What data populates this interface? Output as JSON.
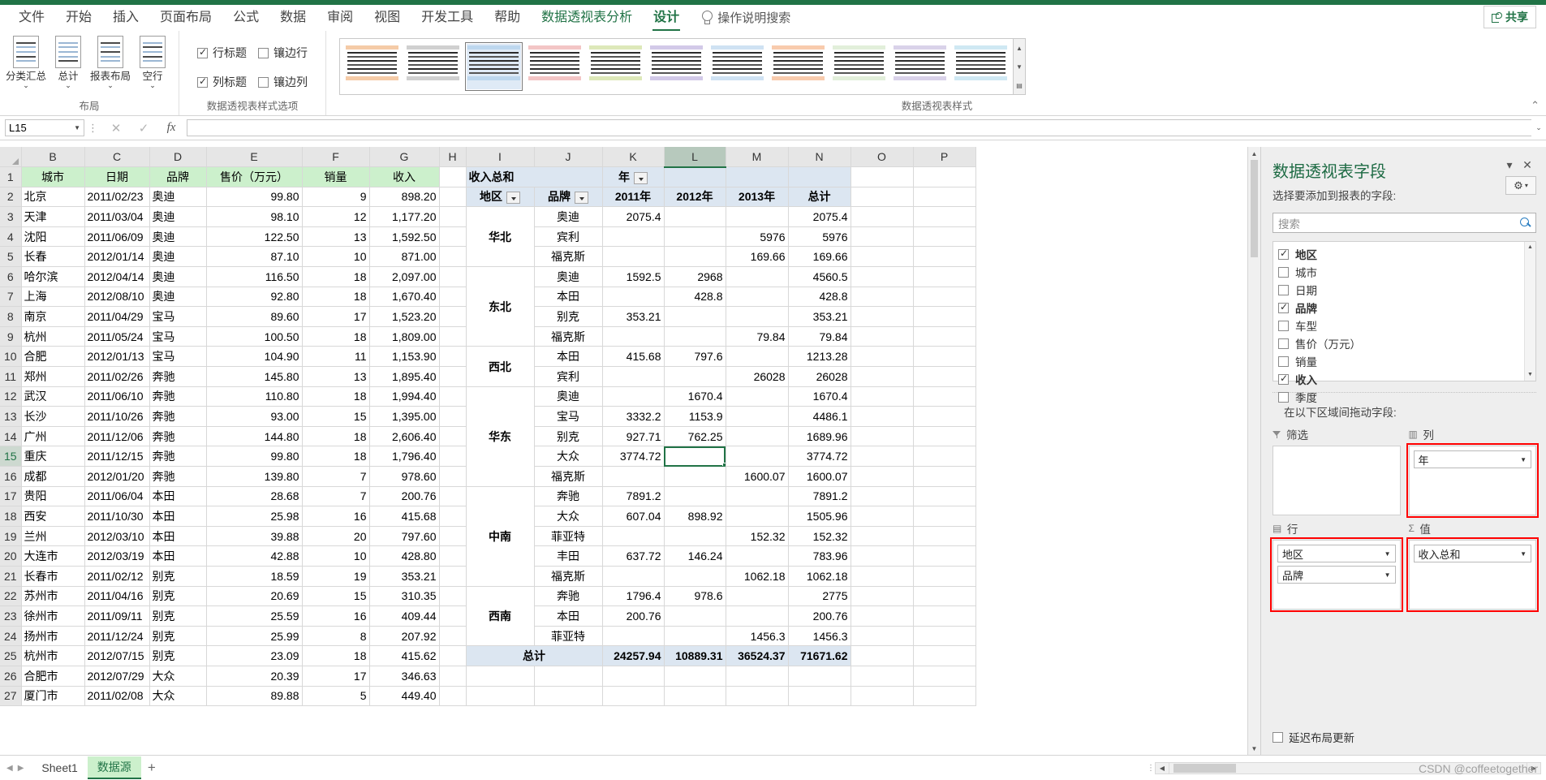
{
  "ribbon": {
    "tabs": [
      {
        "label": "文件",
        "state": "normal"
      },
      {
        "label": "开始",
        "state": "normal"
      },
      {
        "label": "插入",
        "state": "normal"
      },
      {
        "label": "页面布局",
        "state": "normal"
      },
      {
        "label": "公式",
        "state": "normal"
      },
      {
        "label": "数据",
        "state": "normal"
      },
      {
        "label": "审阅",
        "state": "normal"
      },
      {
        "label": "视图",
        "state": "normal"
      },
      {
        "label": "开发工具",
        "state": "normal"
      },
      {
        "label": "帮助",
        "state": "normal"
      },
      {
        "label": "数据透视表分析",
        "state": "context"
      },
      {
        "label": "设计",
        "state": "active"
      }
    ],
    "tell_me": "操作说明搜索",
    "share_label": "共享",
    "layout_group": {
      "title": "布局",
      "buttons": [
        {
          "label": "分类汇总",
          "has_caret": true
        },
        {
          "label": "总计",
          "has_caret": true
        },
        {
          "label": "报表布局",
          "has_caret": true
        },
        {
          "label": "空行",
          "has_caret": true
        }
      ]
    },
    "style_options_group": {
      "title": "数据透视表样式选项",
      "options": [
        {
          "label": "行标题",
          "checked": true
        },
        {
          "label": "镶边行",
          "checked": false
        },
        {
          "label": "列标题",
          "checked": true
        },
        {
          "label": "镶边列",
          "checked": false
        }
      ]
    },
    "styles_group": {
      "title": "数据透视表样式",
      "swatch_colors": [
        "#f5cba7",
        "#d0d0d0",
        "#bdd7ee",
        "#f3c5c5",
        "#dde8b9",
        "#d2c9e8",
        "#cfe2f3",
        "#f8cbad",
        "#e2efda",
        "#d9d2e9",
        "#cfe8f3"
      ],
      "selected_index": 2
    }
  },
  "formula_bar": {
    "name_box": "L15",
    "value": "",
    "cancel_icon": "✕",
    "confirm_icon": "✓",
    "fx_icon": "fx"
  },
  "sheet": {
    "column_headers": [
      "B",
      "C",
      "D",
      "E",
      "F",
      "G",
      "H",
      "I",
      "J",
      "K",
      "L",
      "M",
      "N",
      "O",
      "P"
    ],
    "selected_column": "L",
    "selected_row": 15,
    "selected_cell": "L15",
    "row_numbers": [
      1,
      2,
      3,
      4,
      5,
      6,
      7,
      8,
      9,
      10,
      11,
      12,
      13,
      14,
      15,
      16,
      17,
      18,
      19,
      20,
      21,
      22,
      23,
      24,
      25,
      26,
      27
    ],
    "source_headers": [
      "城市",
      "日期",
      "品牌",
      "售价（万元）",
      "销量",
      "收入"
    ],
    "source_rows": [
      [
        "北京",
        "2011/02/23",
        "奥迪",
        "99.80",
        "9",
        "898.20"
      ],
      [
        "天津",
        "2011/03/04",
        "奥迪",
        "98.10",
        "12",
        "1,177.20"
      ],
      [
        "沈阳",
        "2011/06/09",
        "奥迪",
        "122.50",
        "13",
        "1,592.50"
      ],
      [
        "长春",
        "2012/01/14",
        "奥迪",
        "87.10",
        "10",
        "871.00"
      ],
      [
        "哈尔滨",
        "2012/04/14",
        "奥迪",
        "116.50",
        "18",
        "2,097.00"
      ],
      [
        "上海",
        "2012/08/10",
        "奥迪",
        "92.80",
        "18",
        "1,670.40"
      ],
      [
        "南京",
        "2011/04/29",
        "宝马",
        "89.60",
        "17",
        "1,523.20"
      ],
      [
        "杭州",
        "2011/05/24",
        "宝马",
        "100.50",
        "18",
        "1,809.00"
      ],
      [
        "合肥",
        "2012/01/13",
        "宝马",
        "104.90",
        "11",
        "1,153.90"
      ],
      [
        "郑州",
        "2011/02/26",
        "奔驰",
        "145.80",
        "13",
        "1,895.40"
      ],
      [
        "武汉",
        "2011/06/10",
        "奔驰",
        "110.80",
        "18",
        "1,994.40"
      ],
      [
        "长沙",
        "2011/10/26",
        "奔驰",
        "93.00",
        "15",
        "1,395.00"
      ],
      [
        "广州",
        "2011/12/06",
        "奔驰",
        "144.80",
        "18",
        "2,606.40"
      ],
      [
        "重庆",
        "2011/12/15",
        "奔驰",
        "99.80",
        "18",
        "1,796.40"
      ],
      [
        "成都",
        "2012/01/20",
        "奔驰",
        "139.80",
        "7",
        "978.60"
      ],
      [
        "贵阳",
        "2011/06/04",
        "本田",
        "28.68",
        "7",
        "200.76"
      ],
      [
        "西安",
        "2011/10/30",
        "本田",
        "25.98",
        "16",
        "415.68"
      ],
      [
        "兰州",
        "2012/03/10",
        "本田",
        "39.88",
        "20",
        "797.60"
      ],
      [
        "大连市",
        "2012/03/19",
        "本田",
        "42.88",
        "10",
        "428.80"
      ],
      [
        "长春市",
        "2011/02/12",
        "别克",
        "18.59",
        "19",
        "353.21"
      ],
      [
        "苏州市",
        "2011/04/16",
        "别克",
        "20.69",
        "15",
        "310.35"
      ],
      [
        "徐州市",
        "2011/09/11",
        "别克",
        "25.59",
        "16",
        "409.44"
      ],
      [
        "扬州市",
        "2011/12/24",
        "别克",
        "25.99",
        "8",
        "207.92"
      ],
      [
        "杭州市",
        "2012/07/15",
        "别克",
        "23.09",
        "18",
        "415.62"
      ],
      [
        "合肥市",
        "2012/07/29",
        "大众",
        "20.39",
        "17",
        "346.63"
      ],
      [
        "厦门市",
        "2011/02/08",
        "大众",
        "89.88",
        "5",
        "449.40"
      ]
    ]
  },
  "pivot": {
    "value_title": "收入总和",
    "col_field_label": "年",
    "row_field_label": "地区",
    "row_field_label2": "品牌",
    "column_headers": [
      "2011年",
      "2012年",
      "2013年",
      "总计"
    ],
    "grand_total_label": "总计",
    "groups": [
      {
        "region": "华北",
        "rows": [
          {
            "brand": "奥迪",
            "v": [
              "2075.4",
              "",
              "",
              "2075.4"
            ]
          },
          {
            "brand": "宾利",
            "v": [
              "",
              "",
              "5976",
              "5976"
            ]
          },
          {
            "brand": "福克斯",
            "v": [
              "",
              "",
              "169.66",
              "169.66"
            ]
          }
        ]
      },
      {
        "region": "东北",
        "rows": [
          {
            "brand": "奥迪",
            "v": [
              "1592.5",
              "2968",
              "",
              "4560.5"
            ]
          },
          {
            "brand": "本田",
            "v": [
              "",
              "428.8",
              "",
              "428.8"
            ]
          },
          {
            "brand": "别克",
            "v": [
              "353.21",
              "",
              "",
              "353.21"
            ]
          },
          {
            "brand": "福克斯",
            "v": [
              "",
              "",
              "79.84",
              "79.84"
            ]
          }
        ]
      },
      {
        "region": "西北",
        "rows": [
          {
            "brand": "本田",
            "v": [
              "415.68",
              "797.6",
              "",
              "1213.28"
            ]
          },
          {
            "brand": "宾利",
            "v": [
              "",
              "",
              "26028",
              "26028"
            ]
          }
        ]
      },
      {
        "region": "华东",
        "rows": [
          {
            "brand": "奥迪",
            "v": [
              "",
              "1670.4",
              "",
              "1670.4"
            ]
          },
          {
            "brand": "宝马",
            "v": [
              "3332.2",
              "1153.9",
              "",
              "4486.1"
            ]
          },
          {
            "brand": "别克",
            "v": [
              "927.71",
              "762.25",
              "",
              "1689.96"
            ]
          },
          {
            "brand": "大众",
            "v": [
              "3774.72",
              "",
              "",
              "3774.72"
            ]
          },
          {
            "brand": "福克斯",
            "v": [
              "",
              "",
              "1600.07",
              "1600.07"
            ]
          }
        ]
      },
      {
        "region": "中南",
        "rows": [
          {
            "brand": "奔驰",
            "v": [
              "7891.2",
              "",
              "",
              "7891.2"
            ]
          },
          {
            "brand": "大众",
            "v": [
              "607.04",
              "898.92",
              "",
              "1505.96"
            ]
          },
          {
            "brand": "菲亚特",
            "v": [
              "",
              "",
              "152.32",
              "152.32"
            ]
          },
          {
            "brand": "丰田",
            "v": [
              "637.72",
              "146.24",
              "",
              "783.96"
            ]
          },
          {
            "brand": "福克斯",
            "v": [
              "",
              "",
              "1062.18",
              "1062.18"
            ]
          }
        ]
      },
      {
        "region": "西南",
        "rows": [
          {
            "brand": "奔驰",
            "v": [
              "1796.4",
              "978.6",
              "",
              "2775"
            ]
          },
          {
            "brand": "本田",
            "v": [
              "200.76",
              "",
              "",
              "200.76"
            ]
          },
          {
            "brand": "菲亚特",
            "v": [
              "",
              "",
              "1456.3",
              "1456.3"
            ]
          }
        ]
      }
    ],
    "grand_total_values": [
      "24257.94",
      "10889.31",
      "36524.37",
      "71671.62"
    ]
  },
  "pane": {
    "title": "数据透视表字段",
    "subtitle": "选择要添加到报表的字段:",
    "collapse_icon": "▾",
    "close_icon": "✕",
    "gear_icon": "⚙",
    "gear_caret": "▾",
    "search_placeholder": "搜索",
    "fields": [
      {
        "label": "地区",
        "checked": true
      },
      {
        "label": "城市",
        "checked": false
      },
      {
        "label": "日期",
        "checked": false
      },
      {
        "label": "品牌",
        "checked": true
      },
      {
        "label": "车型",
        "checked": false
      },
      {
        "label": "售价（万元）",
        "checked": false
      },
      {
        "label": "销量",
        "checked": false
      },
      {
        "label": "收入",
        "checked": true
      },
      {
        "label": "季度",
        "checked": false
      }
    ],
    "drag_label": "在以下区域间拖动字段:",
    "zones": [
      {
        "name": "筛选",
        "icon": "funnel",
        "pills": [],
        "highlight": false
      },
      {
        "name": "列",
        "icon": "columns",
        "pills": [
          "年"
        ],
        "highlight": true
      },
      {
        "name": "行",
        "icon": "rows",
        "pills": [
          "地区",
          "品牌"
        ],
        "highlight": true
      },
      {
        "name": "值",
        "icon": "sigma",
        "pills": [
          "收入总和"
        ],
        "highlight": true
      }
    ],
    "defer_label": "延迟布局更新",
    "defer_checked": false
  },
  "status": {
    "sheet_tabs": [
      {
        "label": "Sheet1",
        "active": false
      },
      {
        "label": "数据源",
        "active": true
      }
    ],
    "add_sheet_icon": "+",
    "watermark": "CSDN @coffeetogether"
  },
  "colors": {
    "brand_green": "#217346",
    "header_green": "#ccf0cc",
    "pivot_blue": "#dce6f1",
    "highlight_red": "#ff0000"
  }
}
